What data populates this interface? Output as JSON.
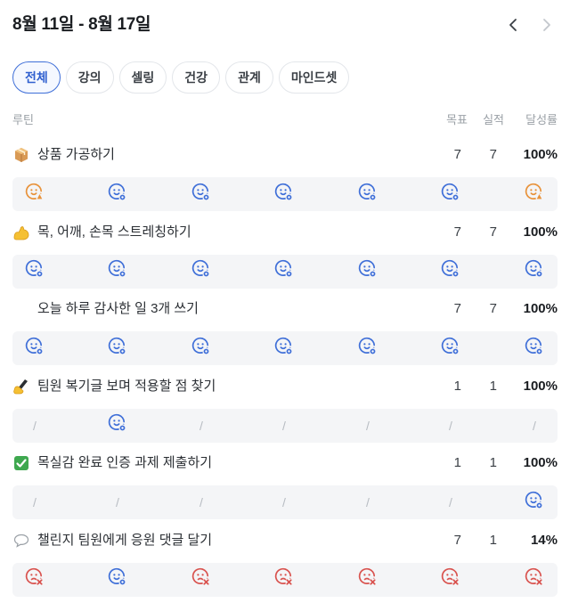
{
  "header": {
    "date_range": "8월 11일 - 8월 17일",
    "prev_icon": "chevron-left-icon",
    "next_icon": "chevron-right-icon"
  },
  "filters": [
    {
      "label": "전체",
      "active": true
    },
    {
      "label": "강의",
      "active": false
    },
    {
      "label": "셀링",
      "active": false
    },
    {
      "label": "건강",
      "active": false
    },
    {
      "label": "관계",
      "active": false
    },
    {
      "label": "마인드셋",
      "active": false
    }
  ],
  "columns": {
    "title": "루틴",
    "goal": "목표",
    "done": "실적",
    "rate": "달성률"
  },
  "colors": {
    "accent": "#3f6fd8",
    "success": "#3f6fd8",
    "pending": "#e8923a",
    "fail": "#d9534f",
    "empty": "#b7bcc2"
  },
  "routines": [
    {
      "emoji": "package-icon",
      "title": "상품 가공하기",
      "goal": "7",
      "done": "7",
      "rate": "100%",
      "days": [
        "pending",
        "done",
        "done",
        "done",
        "done",
        "done",
        "pending"
      ]
    },
    {
      "emoji": "flexed-biceps-icon",
      "title": "목, 어깨, 손목 스트레칭하기",
      "goal": "7",
      "done": "7",
      "rate": "100%",
      "days": [
        "done",
        "done",
        "done",
        "done",
        "done",
        "done",
        "done"
      ]
    },
    {
      "emoji": "",
      "title": "오늘 하루 감사한 일 3개 쓰기",
      "goal": "7",
      "done": "7",
      "rate": "100%",
      "days": [
        "done",
        "done",
        "done",
        "done",
        "done",
        "done",
        "done"
      ]
    },
    {
      "emoji": "writing-hand-icon",
      "title": "팀원 복기글 보며 적용할 점 찾기",
      "goal": "1",
      "done": "1",
      "rate": "100%",
      "days": [
        "none",
        "done",
        "none",
        "none",
        "none",
        "none",
        "none"
      ]
    },
    {
      "emoji": "check-mark-icon",
      "title": "목실감 완료 인증 과제 제출하기",
      "goal": "1",
      "done": "1",
      "rate": "100%",
      "days": [
        "none",
        "none",
        "none",
        "none",
        "none",
        "none",
        "done"
      ]
    },
    {
      "emoji": "speech-bubble-icon",
      "title": "챌린지 팀원에게 응원 댓글 달기",
      "goal": "7",
      "done": "1",
      "rate": "14%",
      "days": [
        "fail",
        "done",
        "fail",
        "fail",
        "fail",
        "fail",
        "fail"
      ]
    }
  ],
  "empty_day_mark": "/"
}
